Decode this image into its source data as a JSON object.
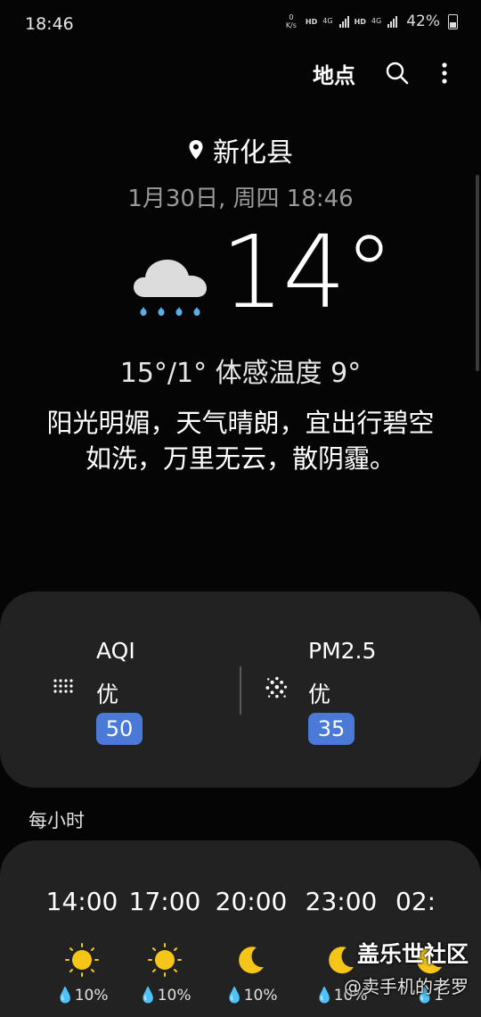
{
  "status_bar": {
    "time": "18:46",
    "net_speed_value": "0",
    "net_speed_unit": "K/s",
    "hd1": "HD",
    "sig1": "4G",
    "hd2": "HD",
    "sig2": "4G",
    "battery": "42%"
  },
  "app_bar": {
    "places_label": "地点",
    "search_icon": "search-icon",
    "more_icon": "more-vertical-icon"
  },
  "current": {
    "location": "新化县",
    "datetime": "1月30日, 周四 18:46",
    "temperature": "14°",
    "hilo_feels": "15°/1° 体感温度 9°",
    "description": "阳光明媚，天气晴朗，宜出行碧空如洗，万里无云，散阴霾。",
    "condition_icon": "rain-cloud-icon"
  },
  "air": {
    "aqi_label": "AQI",
    "aqi_status": "优",
    "aqi_value": "50",
    "pm_label": "PM2.5",
    "pm_status": "优",
    "pm_value": "35",
    "badge_color": "#4a79d8"
  },
  "hourly": {
    "title": "每小时",
    "items": [
      {
        "time": "14:00",
        "icon": "sun-icon",
        "precip": "10%"
      },
      {
        "time": "17:00",
        "icon": "sun-icon",
        "precip": "10%"
      },
      {
        "time": "20:00",
        "icon": "moon-icon",
        "precip": "10%"
      },
      {
        "time": "23:00",
        "icon": "moon-icon",
        "precip": "10%"
      },
      {
        "time": "02:",
        "icon": "moon-icon",
        "precip": "1"
      }
    ]
  },
  "watermark": {
    "brand": "盖乐世社区",
    "sub": "@卖手机的老罗"
  },
  "colors": {
    "background": "#050505",
    "card": "#222222",
    "sun": "#f5c518",
    "accent": "#4a79d8"
  }
}
